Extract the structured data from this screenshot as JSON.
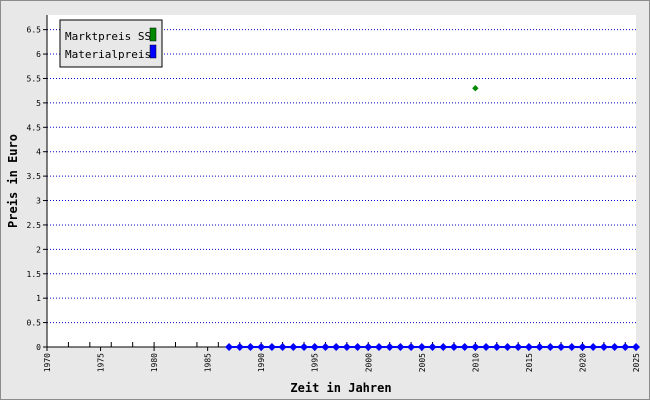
{
  "chart_data": {
    "type": "scatter",
    "title": "",
    "xlabel": "Zeit in Jahren",
    "ylabel": "Preis in Euro",
    "xlim": [
      1970,
      2025
    ],
    "ylim": [
      0,
      6.8
    ],
    "x_ticks": [
      "1970",
      "1975",
      "1980",
      "1985",
      "1990",
      "1995",
      "2000",
      "2005",
      "2010",
      "2015",
      "2020",
      "2025"
    ],
    "y_ticks": [
      "0",
      "0.5",
      "1",
      "1.5",
      "2",
      "2.5",
      "3",
      "3.5",
      "4",
      "4.5",
      "5",
      "5.5",
      "6",
      "6.5"
    ],
    "grid": true,
    "legend_position": "top-left",
    "series": [
      {
        "name": "Marktpreis SS",
        "color": "#008800",
        "points": [
          {
            "x": 2010,
            "y": 5.3
          }
        ]
      },
      {
        "name": "Materialpreis",
        "color": "#0000ff",
        "line": true,
        "points": [
          {
            "x": 1987,
            "y": 0
          },
          {
            "x": 1988,
            "y": 0
          },
          {
            "x": 1989,
            "y": 0
          },
          {
            "x": 1990,
            "y": 0
          },
          {
            "x": 1991,
            "y": 0
          },
          {
            "x": 1992,
            "y": 0
          },
          {
            "x": 1993,
            "y": 0
          },
          {
            "x": 1994,
            "y": 0
          },
          {
            "x": 1995,
            "y": 0
          },
          {
            "x": 1996,
            "y": 0
          },
          {
            "x": 1997,
            "y": 0
          },
          {
            "x": 1998,
            "y": 0
          },
          {
            "x": 1999,
            "y": 0
          },
          {
            "x": 2000,
            "y": 0
          },
          {
            "x": 2001,
            "y": 0
          },
          {
            "x": 2002,
            "y": 0
          },
          {
            "x": 2003,
            "y": 0
          },
          {
            "x": 2004,
            "y": 0
          },
          {
            "x": 2005,
            "y": 0
          },
          {
            "x": 2006,
            "y": 0
          },
          {
            "x": 2007,
            "y": 0
          },
          {
            "x": 2008,
            "y": 0
          },
          {
            "x": 2009,
            "y": 0
          },
          {
            "x": 2010,
            "y": 0
          },
          {
            "x": 2011,
            "y": 0
          },
          {
            "x": 2012,
            "y": 0
          },
          {
            "x": 2013,
            "y": 0
          },
          {
            "x": 2014,
            "y": 0
          },
          {
            "x": 2015,
            "y": 0
          },
          {
            "x": 2016,
            "y": 0
          },
          {
            "x": 2017,
            "y": 0
          },
          {
            "x": 2018,
            "y": 0
          },
          {
            "x": 2019,
            "y": 0
          },
          {
            "x": 2020,
            "y": 0
          },
          {
            "x": 2021,
            "y": 0
          },
          {
            "x": 2022,
            "y": 0
          },
          {
            "x": 2023,
            "y": 0
          },
          {
            "x": 2024,
            "y": 0
          },
          {
            "x": 2025,
            "y": 0
          }
        ]
      }
    ]
  }
}
